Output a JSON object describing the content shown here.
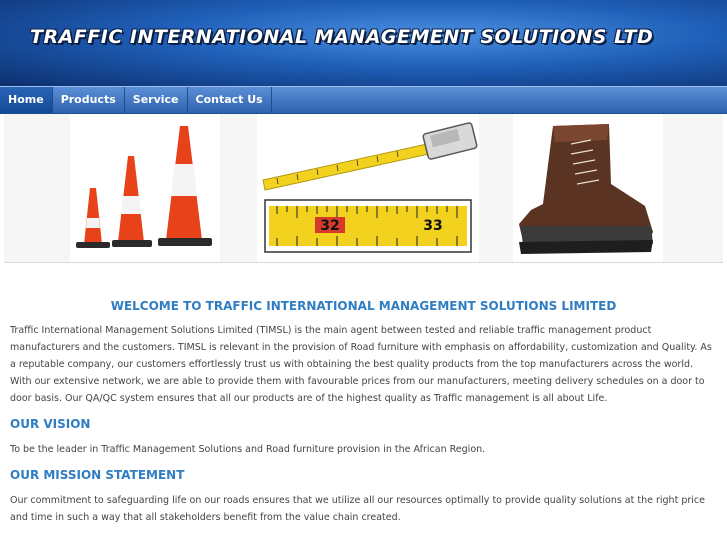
{
  "header": {
    "title": "TRAFFIC INTERNATIONAL MANAGEMENT SOLUTIONS LTD"
  },
  "nav": {
    "items": [
      {
        "label": "Home"
      },
      {
        "label": "Products"
      },
      {
        "label": "Service"
      },
      {
        "label": "Contact Us"
      }
    ]
  },
  "banner": {
    "tape_labels": [
      "32",
      "33"
    ]
  },
  "main": {
    "welcome_heading": "WELCOME TO TRAFFIC INTERNATIONAL MANAGEMENT SOLUTIONS LIMITED",
    "intro": "Traffic International Management Solutions Limited (TIMSL) is the main agent between tested and reliable traffic management product manufacturers and the customers. TIMSL is relevant in the provision of Road furniture with emphasis on affordability, customization and Quality. As a reputable company, our customers effortlessly trust us with obtaining the best quality products from the top manufacturers across the world. With our extensive network, we are able to provide them with favourable prices from our manufacturers, meeting delivery schedules on a door to door basis. Our QA/QC system ensures that all our products are of the highest quality as Traffic management is all about Life.",
    "vision_heading": "OUR VISION",
    "vision_text": "To be the leader in Traffic Management Solutions and Road furniture provision in the African Region.",
    "mission_heading": "OUR MISSION STATEMENT",
    "mission_text": "Our commitment to safeguarding life on our roads ensures that we utilize all our resources optimally to provide quality solutions at the right price and time in such a way that all stakeholders benefit from the value chain created."
  },
  "colors": {
    "header_blue": "#1f5fb8",
    "heading_blue": "#2f7dc2",
    "cone_orange": "#e8421a"
  }
}
